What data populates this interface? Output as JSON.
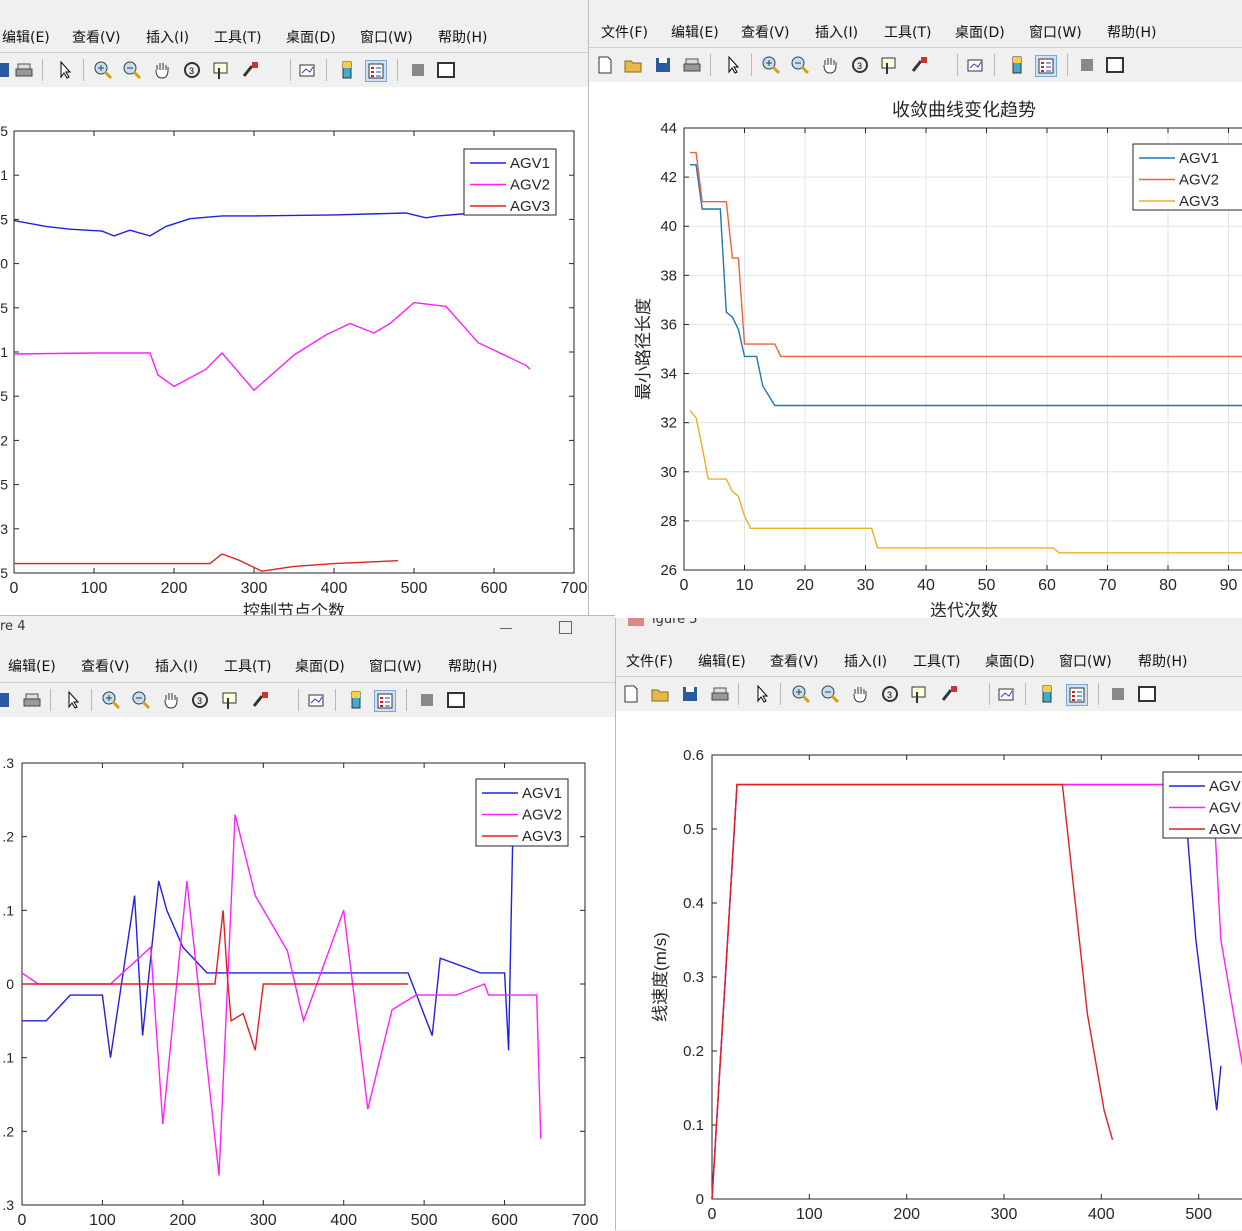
{
  "menus": {
    "tl": [
      "编辑(E)",
      "查看(V)",
      "插入(I)",
      "工具(T)",
      "桌面(D)",
      "窗口(W)",
      "帮助(H)"
    ],
    "tr": [
      "文件(F)",
      "编辑(E)",
      "查看(V)",
      "插入(I)",
      "工具(T)",
      "桌面(D)",
      "窗口(W)",
      "帮助(H)"
    ],
    "bl": [
      "编辑(E)",
      "查看(V)",
      "插入(I)",
      "工具(T)",
      "桌面(D)",
      "窗口(W)",
      "帮助(H)"
    ],
    "br": [
      "文件(F)",
      "编辑(E)",
      "查看(V)",
      "插入(I)",
      "工具(T)",
      "桌面(D)",
      "窗口(W)",
      "帮助(H)"
    ]
  },
  "window_titles": {
    "bl": "re 4",
    "br": "igure 5"
  },
  "colors": {
    "agv1_blue": "#2020e0",
    "agv2_magenta": "#ff20ff",
    "agv3_red": "#e02020",
    "conv_agv1": "#1f77b4",
    "conv_agv2": "#e8663a",
    "conv_agv3": "#edb120"
  },
  "chart_data": [
    {
      "type": "line",
      "xlabel": "控制节点个数",
      "ylabel": "",
      "xlim": [
        0,
        700
      ],
      "xticks": [
        "0",
        "100",
        "200",
        "300",
        "400",
        "500",
        "600",
        "700"
      ],
      "yticks": [
        ".5",
        "1",
        ".5",
        "0",
        ".5",
        "1",
        ".5",
        "2",
        ".5",
        "3",
        ".5"
      ],
      "legend": [
        "AGV1",
        "AGV2",
        "AGV3"
      ],
      "legend_position": "top-right",
      "grid": false,
      "series": [
        {
          "name": "AGV1",
          "color": "#2020e0",
          "x": [
            0,
            40,
            70,
            110,
            125,
            145,
            170,
            190,
            220,
            260,
            300,
            400,
            490,
            500,
            515,
            530,
            560,
            650
          ],
          "y": [
            9.2,
            9.8,
            10.1,
            10.3,
            10.8,
            10.2,
            10.8,
            9.8,
            9,
            8.7,
            8.7,
            8.6,
            8.4,
            8.6,
            8.9,
            8.7,
            8.5,
            8.3
          ]
        },
        {
          "name": "AGV2",
          "color": "#ff20ff",
          "x": [
            0,
            100,
            170,
            180,
            200,
            240,
            260,
            300,
            350,
            390,
            420,
            450,
            470,
            500,
            540,
            580,
            640,
            645
          ],
          "y": [
            23.2,
            23.1,
            23.1,
            25.4,
            26.6,
            24.8,
            23.1,
            27,
            23.3,
            21.2,
            20,
            21,
            20,
            17.8,
            18.2,
            22,
            24.4,
            24.8
          ]
        },
        {
          "name": "AGV3",
          "color": "#e02020",
          "x": [
            0,
            100,
            200,
            245,
            260,
            280,
            310,
            350,
            400,
            480
          ],
          "y": [
            45.2,
            45.2,
            45.2,
            45.2,
            44.2,
            44.8,
            46,
            45.5,
            45.2,
            44.9
          ]
        }
      ]
    },
    {
      "type": "line",
      "title": "收敛曲线变化趋势",
      "xlabel": "迭代次数",
      "ylabel": "最小路径长度",
      "xlim": [
        0,
        100
      ],
      "ylim": [
        26,
        44
      ],
      "xticks": [
        "0",
        "10",
        "20",
        "30",
        "40",
        "50",
        "60",
        "70",
        "80",
        "90",
        "10"
      ],
      "yticks": [
        "26",
        "28",
        "30",
        "32",
        "34",
        "36",
        "38",
        "40",
        "42",
        "44"
      ],
      "legend": [
        "AGV1",
        "AGV2",
        "AGV3"
      ],
      "legend_position": "top-right",
      "grid": true,
      "series": [
        {
          "name": "AGV1",
          "color": "#1f77b4",
          "x": [
            1,
            2,
            3,
            6,
            7,
            8,
            9,
            10,
            12,
            13,
            15,
            100
          ],
          "y": [
            42.5,
            42.5,
            40.7,
            40.7,
            36.5,
            36.3,
            35.8,
            34.7,
            34.7,
            33.5,
            32.7,
            32.7
          ]
        },
        {
          "name": "AGV2",
          "color": "#e8663a",
          "x": [
            1,
            2,
            3,
            7,
            8,
            9,
            10,
            15,
            16,
            100
          ],
          "y": [
            43,
            43,
            41,
            41,
            38.7,
            38.7,
            35.2,
            35.2,
            34.7,
            34.7
          ]
        },
        {
          "name": "AGV3",
          "color": "#edb120",
          "x": [
            1,
            2,
            3,
            4,
            7,
            8,
            9,
            10,
            11,
            31,
            32,
            61,
            62,
            100
          ],
          "y": [
            32.5,
            32.2,
            31,
            29.7,
            29.7,
            29.2,
            29,
            28.2,
            27.7,
            27.7,
            26.9,
            26.9,
            26.7,
            26.7
          ]
        }
      ]
    },
    {
      "type": "line",
      "xlabel": "",
      "ylabel": "",
      "xlim": [
        0,
        700
      ],
      "ylim": [
        -0.3,
        0.3
      ],
      "xticks": [
        "0",
        "100",
        "200",
        "300",
        "400",
        "500",
        "600",
        "700"
      ],
      "yticks": [
        ".3",
        ".2",
        ".1",
        "0",
        ".1",
        ".2",
        ".3"
      ],
      "legend": [
        "AGV1",
        "AGV2",
        "AGV3"
      ],
      "legend_position": "top-right",
      "grid": false,
      "series": [
        {
          "name": "AGV1",
          "color": "#2020e0",
          "x": [
            0,
            30,
            60,
            100,
            110,
            140,
            150,
            170,
            180,
            200,
            230,
            280,
            380,
            480,
            510,
            520,
            570,
            600,
            605,
            610
          ],
          "y": [
            -0.05,
            -0.05,
            -0.015,
            -0.015,
            -0.1,
            0.12,
            -0.07,
            0.14,
            0.1,
            0.05,
            0.015,
            0.015,
            0.015,
            0.015,
            -0.07,
            0.035,
            0.015,
            0.015,
            -0.09,
            0.19
          ]
        },
        {
          "name": "AGV2",
          "color": "#ff20ff",
          "x": [
            0,
            20,
            60,
            110,
            160,
            175,
            205,
            245,
            265,
            290,
            330,
            350,
            400,
            430,
            460,
            490,
            540,
            575,
            580,
            640,
            645
          ],
          "y": [
            0.015,
            0,
            0,
            0,
            0.05,
            -0.19,
            0.14,
            -0.26,
            0.23,
            0.12,
            0.045,
            -0.05,
            0.1,
            -0.17,
            -0.035,
            -0.015,
            -0.015,
            0,
            -0.015,
            -0.015,
            -0.21
          ]
        },
        {
          "name": "AGV3",
          "color": "#e02020",
          "x": [
            0,
            240,
            250,
            255,
            260,
            275,
            290,
            300,
            310,
            480
          ],
          "y": [
            0,
            0,
            0.1,
            0.015,
            -0.05,
            -0.04,
            -0.09,
            0,
            0,
            0
          ]
        }
      ]
    },
    {
      "type": "line",
      "xlabel": "",
      "ylabel": "线速度(m/s)",
      "xlim": [
        0,
        700
      ],
      "ylim": [
        0,
        0.6
      ],
      "xticks": [
        "0",
        "100",
        "200",
        "300",
        "400",
        "500",
        "600"
      ],
      "yticks": [
        "0",
        "0.1",
        "0.2",
        "0.3",
        "0.4",
        "0.5",
        "0.6"
      ],
      "legend": [
        "AGV",
        "AGV",
        "AGV"
      ],
      "legend_position": "top-right",
      "grid": false,
      "series": [
        {
          "name": "AGV",
          "color": "#2020e0",
          "x": [
            0,
            30,
            565,
            580,
            605,
            610
          ],
          "y": [
            0,
            0.56,
            0.56,
            0.35,
            0.12,
            0.18
          ]
        },
        {
          "name": "AGV",
          "color": "#ff20ff",
          "x": [
            0,
            30,
            600,
            610,
            645,
            650
          ],
          "y": [
            0,
            0.56,
            0.56,
            0.35,
            0.12,
            0.18
          ]
        },
        {
          "name": "AGV",
          "color": "#e02020",
          "x": [
            0,
            30,
            420,
            450,
            470,
            480
          ],
          "y": [
            0,
            0.56,
            0.56,
            0.25,
            0.12,
            0.08
          ]
        }
      ]
    }
  ]
}
